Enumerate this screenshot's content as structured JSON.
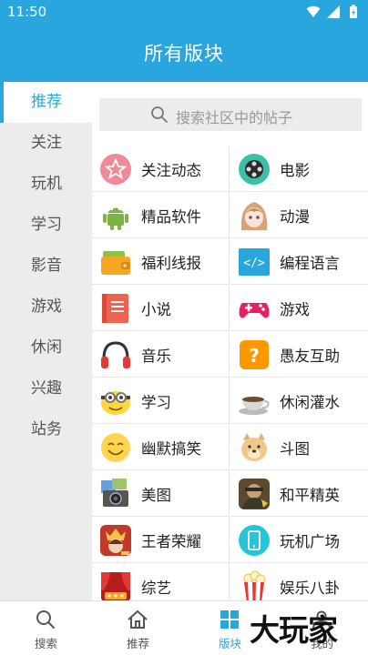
{
  "status": {
    "time": "11:50",
    "icons": [
      "wifi-icon",
      "signal-icon",
      "battery-icon"
    ]
  },
  "header": {
    "title": "所有版块"
  },
  "sidebar": {
    "items": [
      {
        "label": "推荐",
        "active": true
      },
      {
        "label": "关注"
      },
      {
        "label": "玩机"
      },
      {
        "label": "学习"
      },
      {
        "label": "影音"
      },
      {
        "label": "游戏"
      },
      {
        "label": "休闲"
      },
      {
        "label": "兴趣"
      },
      {
        "label": "站务"
      }
    ]
  },
  "search": {
    "placeholder": "搜索社区中的帖子"
  },
  "boards": [
    {
      "label": "关注动态",
      "icon": "star-icon"
    },
    {
      "label": "电影",
      "icon": "film-reel-icon"
    },
    {
      "label": "精品软件",
      "icon": "android-icon"
    },
    {
      "label": "动漫",
      "icon": "anime-girl-icon"
    },
    {
      "label": "福利线报",
      "icon": "wallet-icon"
    },
    {
      "label": "编程语言",
      "icon": "code-icon"
    },
    {
      "label": "小说",
      "icon": "book-icon"
    },
    {
      "label": "游戏",
      "icon": "gamepad-icon"
    },
    {
      "label": "音乐",
      "icon": "headphones-icon"
    },
    {
      "label": "愚友互助",
      "icon": "question-icon"
    },
    {
      "label": "学习",
      "icon": "minion-icon"
    },
    {
      "label": "休闲灌水",
      "icon": "coffee-cup-icon"
    },
    {
      "label": "幽默搞笑",
      "icon": "smile-icon"
    },
    {
      "label": "斗图",
      "icon": "doge-icon"
    },
    {
      "label": "美图",
      "icon": "camera-icon"
    },
    {
      "label": "和平精英",
      "icon": "peace-elite-icon"
    },
    {
      "label": "王者荣耀",
      "icon": "honor-of-kings-icon"
    },
    {
      "label": "玩机广场",
      "icon": "phone-icon"
    },
    {
      "label": "综艺",
      "icon": "stage-icon"
    },
    {
      "label": "娱乐八卦",
      "icon": "popcorn-icon"
    }
  ],
  "tabs": [
    {
      "label": "搜索",
      "icon": "search-icon"
    },
    {
      "label": "推荐",
      "icon": "home-icon"
    },
    {
      "label": "版块",
      "icon": "grid-icon",
      "active": true
    },
    {
      "label": "我的",
      "icon": "profile-icon"
    }
  ],
  "watermark": "大玩家",
  "colors": {
    "accent": "#2aa6df",
    "sidebar_bg": "#ececec"
  }
}
